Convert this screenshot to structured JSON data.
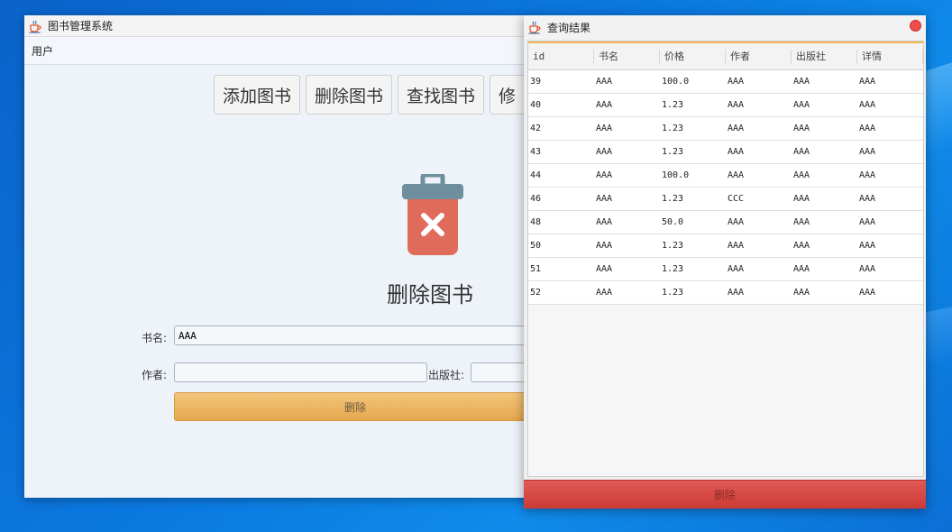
{
  "main_window": {
    "title": "图书管理系统",
    "menu": [
      "用户"
    ],
    "toolbar": [
      "添加图书",
      "删除图书",
      "查找图书",
      "修"
    ],
    "heading": "删除图书",
    "form": {
      "book_name_label": "书名:",
      "book_name_value": "AAA",
      "author_label": "作者:",
      "author_value": "",
      "publisher_label": "出版社:",
      "publisher_value": "",
      "delete_button": "删除"
    },
    "colors": {
      "delete_button": "#e9ac52",
      "trash_body": "#e06b5a",
      "trash_lid": "#6f8e9e"
    }
  },
  "dialog": {
    "title": "查询结果",
    "columns": [
      "id",
      "书名",
      "价格",
      "作者",
      "出版社",
      "详情"
    ],
    "rows": [
      [
        "39",
        "AAA",
        "100.0",
        "AAA",
        "AAA",
        "AAA"
      ],
      [
        "40",
        "AAA",
        "1.23",
        "AAA",
        "AAA",
        "AAA"
      ],
      [
        "42",
        "AAA",
        "1.23",
        "AAA",
        "AAA",
        "AAA"
      ],
      [
        "43",
        "AAA",
        "1.23",
        "AAA",
        "AAA",
        "AAA"
      ],
      [
        "44",
        "AAA",
        "100.0",
        "AAA",
        "AAA",
        "AAA"
      ],
      [
        "46",
        "AAA",
        "1.23",
        "CCC",
        "AAA",
        "AAA"
      ],
      [
        "48",
        "AAA",
        "50.0",
        "AAA",
        "AAA",
        "AAA"
      ],
      [
        "50",
        "AAA",
        "1.23",
        "AAA",
        "AAA",
        "AAA"
      ],
      [
        "51",
        "AAA",
        "1.23",
        "AAA",
        "AAA",
        "AAA"
      ],
      [
        "52",
        "AAA",
        "1.23",
        "AAA",
        "AAA",
        "AAA"
      ]
    ],
    "delete_button": "删除",
    "colors": {
      "delete_button": "#d9473f",
      "accent": "#f0b455"
    }
  }
}
